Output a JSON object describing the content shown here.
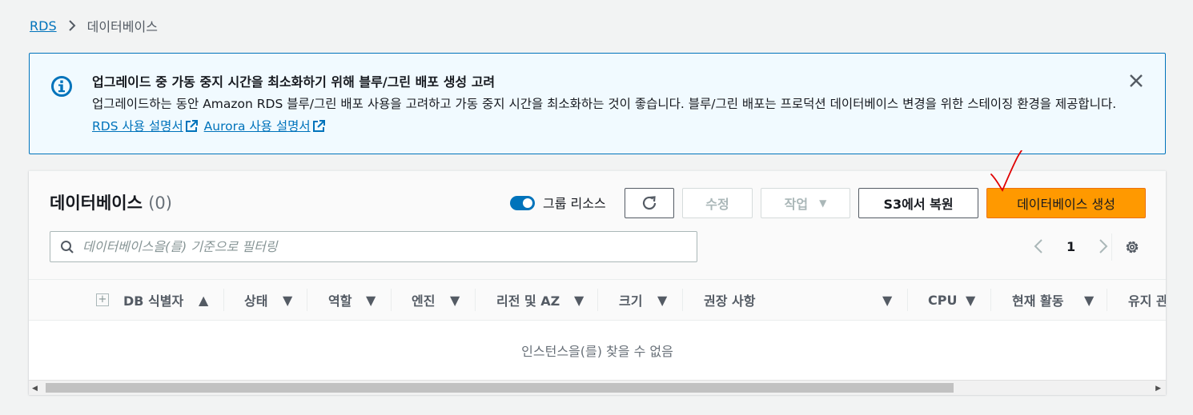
{
  "breadcrumb": {
    "root": "RDS",
    "current": "데이터베이스"
  },
  "flash": {
    "title": "업그레이드 중 가동 중지 시간을 최소화하기 위해 블루/그린 배포 생성 고려",
    "body": "업그레이드하는 동안 Amazon RDS 블루/그린 배포 사용을 고려하고 가동 중지 시간을 최소화하는 것이 좋습니다. 블루/그린 배포는 프로덕션 데이터베이스 변경을 위한 스테이징 환경을 제공합니다.",
    "link_rds": "RDS 사용 설명서",
    "link_aurora": "Aurora 사용 설명서",
    "type": "info",
    "border_color": "#0073bb",
    "background_color": "#f1faff"
  },
  "panel": {
    "title": "데이터베이스",
    "count": "(0)",
    "group_toggle_label": "그룹 리소스",
    "group_toggle_on": true,
    "refresh_icon": "refresh-icon",
    "modify_label": "수정",
    "actions_label": "작업",
    "restore_label": "S3에서 복원",
    "create_label": "데이터베이스 생성",
    "primary_color": "#ff9900",
    "search_placeholder": "데이터베이스을(를) 기준으로 필터링",
    "page_number": "1"
  },
  "table": {
    "columns": [
      {
        "label": "DB 식별자",
        "sort": "asc"
      },
      {
        "label": "상태",
        "sort": "none"
      },
      {
        "label": "역할",
        "sort": "none"
      },
      {
        "label": "엔진",
        "sort": "none"
      },
      {
        "label": "리전 및 AZ",
        "sort": "none"
      },
      {
        "label": "크기",
        "sort": "none"
      },
      {
        "label": "권장 사항",
        "sort": "none"
      },
      {
        "label": "CPU",
        "sort": "none"
      },
      {
        "label": "현재 활동",
        "sort": "none"
      },
      {
        "label": "유지 관",
        "sort": "none"
      }
    ],
    "empty_message": "인스턴스을(를) 찾을 수 없음"
  },
  "annotation": {
    "color": "#e00000",
    "description": "red check mark"
  }
}
